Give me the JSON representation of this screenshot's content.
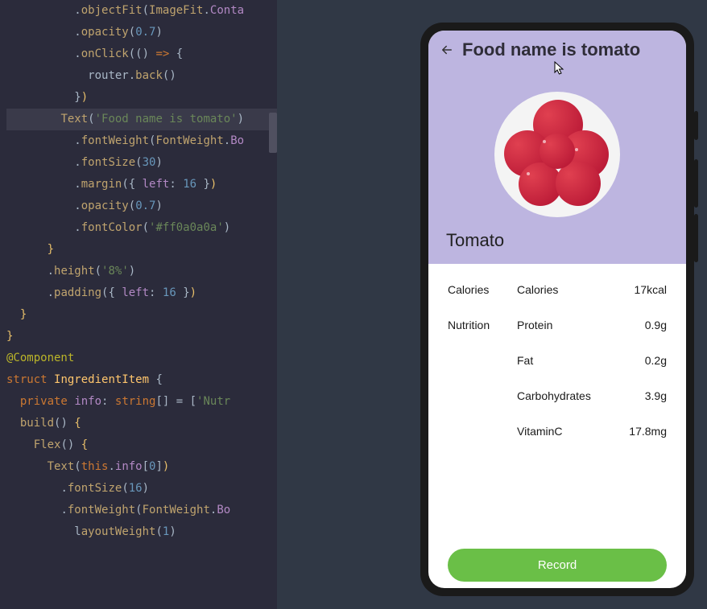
{
  "editor": {
    "lines": [
      {
        "indent": 5,
        "segments": [
          [
            ".",
            "dot"
          ],
          [
            "objectFit",
            "fn"
          ],
          [
            "(",
            "punc"
          ],
          [
            "ImageFit",
            "type"
          ],
          [
            ".",
            "dot"
          ],
          [
            "Conta",
            "prop"
          ]
        ]
      },
      {
        "indent": 5,
        "segments": [
          [
            ".",
            "dot"
          ],
          [
            "opacity",
            "fn"
          ],
          [
            "(",
            "punc"
          ],
          [
            "0.7",
            "num"
          ],
          [
            ")",
            "punc"
          ]
        ]
      },
      {
        "indent": 5,
        "segments": [
          [
            ".",
            "dot"
          ],
          [
            "onClick",
            "fn"
          ],
          [
            "((",
            "punc"
          ],
          [
            ") ",
            "punc"
          ],
          [
            "=>",
            "kw"
          ],
          [
            " {",
            "punc"
          ]
        ]
      },
      {
        "indent": 6,
        "segments": [
          [
            "router",
            "var"
          ],
          [
            ".",
            "dot"
          ],
          [
            "back",
            "fn"
          ],
          [
            "()",
            "punc"
          ]
        ]
      },
      {
        "indent": 5,
        "segments": [
          [
            "}",
            "punc"
          ],
          [
            ")",
            "brace"
          ]
        ]
      },
      {
        "indent": 0,
        "segments": [
          [
            "",
            "var"
          ]
        ]
      },
      {
        "highlighted": true,
        "indent": 4,
        "segments": [
          [
            "Text",
            "fn"
          ],
          [
            "(",
            "punc"
          ],
          [
            "'Food name is tomato'",
            "str"
          ],
          [
            ")",
            "punc"
          ]
        ]
      },
      {
        "indent": 5,
        "segments": [
          [
            ".",
            "dot"
          ],
          [
            "fontWeight",
            "fn"
          ],
          [
            "(",
            "punc"
          ],
          [
            "FontWeight",
            "type"
          ],
          [
            ".",
            "dot"
          ],
          [
            "Bo",
            "prop"
          ]
        ]
      },
      {
        "indent": 5,
        "segments": [
          [
            ".",
            "dot"
          ],
          [
            "fontSize",
            "fn"
          ],
          [
            "(",
            "punc"
          ],
          [
            "30",
            "num"
          ],
          [
            ")",
            "punc"
          ]
        ]
      },
      {
        "indent": 5,
        "segments": [
          [
            ".",
            "dot"
          ],
          [
            "margin",
            "fn"
          ],
          [
            "(",
            "punc"
          ],
          [
            "{ ",
            "punc"
          ],
          [
            "left",
            "prop"
          ],
          [
            ": ",
            "punc"
          ],
          [
            "16",
            "num"
          ],
          [
            " }",
            "punc"
          ],
          [
            ")",
            "brace"
          ]
        ]
      },
      {
        "indent": 5,
        "segments": [
          [
            ".",
            "dot"
          ],
          [
            "opacity",
            "fn"
          ],
          [
            "(",
            "punc"
          ],
          [
            "0.7",
            "num"
          ],
          [
            ")",
            "punc"
          ]
        ]
      },
      {
        "indent": 5,
        "segments": [
          [
            ".",
            "dot"
          ],
          [
            "fontColor",
            "fn"
          ],
          [
            "(",
            "punc"
          ],
          [
            "'#ff0a0a0a'",
            "str"
          ],
          [
            ")",
            "punc"
          ]
        ]
      },
      {
        "indent": 3,
        "segments": [
          [
            "}",
            "brace"
          ]
        ]
      },
      {
        "indent": 3,
        "segments": [
          [
            ".",
            "dot"
          ],
          [
            "height",
            "fn"
          ],
          [
            "(",
            "punc"
          ],
          [
            "'8%'",
            "str"
          ],
          [
            ")",
            "punc"
          ]
        ]
      },
      {
        "indent": 3,
        "segments": [
          [
            ".",
            "dot"
          ],
          [
            "padding",
            "fn"
          ],
          [
            "(",
            "punc"
          ],
          [
            "{ ",
            "punc"
          ],
          [
            "left",
            "prop"
          ],
          [
            ": ",
            "punc"
          ],
          [
            "16",
            "num"
          ],
          [
            " }",
            "punc"
          ],
          [
            ")",
            "brace"
          ]
        ]
      },
      {
        "indent": 1,
        "segments": [
          [
            "}",
            "brace"
          ]
        ]
      },
      {
        "indent": 0,
        "segments": [
          [
            "}",
            "brace"
          ]
        ]
      },
      {
        "indent": 0,
        "segments": [
          [
            "",
            "var"
          ]
        ]
      },
      {
        "indent": 0,
        "segments": [
          [
            "@Component",
            "meta"
          ]
        ]
      },
      {
        "indent": 0,
        "segments": [
          [
            "struct",
            "kw"
          ],
          [
            " ",
            "var"
          ],
          [
            "IngredientItem",
            "struct"
          ],
          [
            " {",
            "punc"
          ]
        ]
      },
      {
        "indent": 1,
        "segments": [
          [
            "private",
            "kw"
          ],
          [
            " ",
            "var"
          ],
          [
            "info",
            "prop"
          ],
          [
            ": ",
            "punc"
          ],
          [
            "string",
            "kw"
          ],
          [
            "[] = [",
            "punc"
          ],
          [
            "'Nutr",
            "str"
          ]
        ]
      },
      {
        "indent": 0,
        "segments": [
          [
            "",
            "var"
          ]
        ]
      },
      {
        "indent": 1,
        "segments": [
          [
            "build",
            "fn"
          ],
          [
            "()",
            "punc"
          ],
          [
            " {",
            "brace"
          ]
        ]
      },
      {
        "indent": 2,
        "segments": [
          [
            "Flex",
            "fn"
          ],
          [
            "()",
            "punc"
          ],
          [
            " {",
            "brace"
          ]
        ]
      },
      {
        "indent": 3,
        "segments": [
          [
            "Text",
            "fn"
          ],
          [
            "(",
            "punc"
          ],
          [
            "this",
            "kw"
          ],
          [
            ".",
            "dot"
          ],
          [
            "info",
            "prop"
          ],
          [
            "[",
            "punc"
          ],
          [
            "0",
            "num"
          ],
          [
            "]",
            "punc"
          ],
          [
            ")",
            "brace"
          ]
        ]
      },
      {
        "indent": 4,
        "segments": [
          [
            ".",
            "dot"
          ],
          [
            "fontSize",
            "fn"
          ],
          [
            "(",
            "punc"
          ],
          [
            "16",
            "num"
          ],
          [
            ")",
            "punc"
          ]
        ]
      },
      {
        "indent": 4,
        "segments": [
          [
            ".",
            "dot"
          ],
          [
            "fontWeight",
            "fn"
          ],
          [
            "(",
            "punc"
          ],
          [
            "FontWeight",
            "type"
          ],
          [
            ".",
            "dot"
          ],
          [
            "Bo",
            "prop"
          ]
        ]
      },
      {
        "indent": 4,
        "partial": true,
        "segments": [
          [
            "  l",
            "dot"
          ],
          [
            "ayout",
            "fn"
          ],
          [
            "Weight",
            "fn"
          ],
          [
            "(",
            "punc"
          ],
          [
            "1",
            "num"
          ],
          [
            ")",
            "punc"
          ]
        ]
      }
    ]
  },
  "app": {
    "title": "Food name is tomato",
    "foodName": "Tomato",
    "rows": [
      {
        "category": "Calories",
        "label": "Calories",
        "value": "17kcal"
      },
      {
        "category": "Nutrition",
        "label": "Protein",
        "value": "0.9g"
      },
      {
        "category": "",
        "label": "Fat",
        "value": "0.2g"
      },
      {
        "category": "",
        "label": "Carbohydrates",
        "value": "3.9g"
      },
      {
        "category": "",
        "label": "VitaminC",
        "value": "17.8mg"
      }
    ],
    "recordLabel": "Record"
  }
}
